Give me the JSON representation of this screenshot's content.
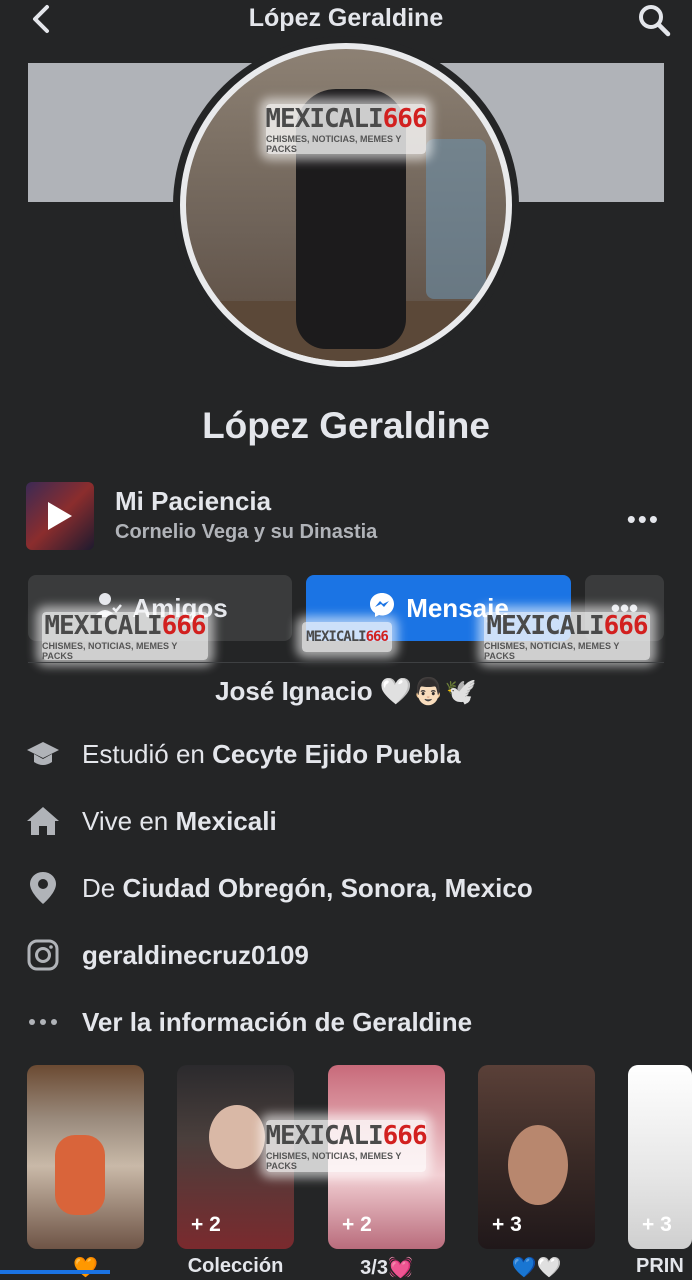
{
  "header": {
    "title": "López Geraldine",
    "back_icon": "chevron-left-icon",
    "search_icon": "search-icon"
  },
  "watermark": {
    "brand_white": "MEXICALI",
    "brand_red": "666",
    "tagline": "CHISMES, NOTICIAS, MEMES Y PACKS"
  },
  "profile": {
    "name": "López Geraldine"
  },
  "music": {
    "title": "Mi Paciencia",
    "artist": "Cornelio Vega y su Dinastia",
    "more": "•••"
  },
  "actions": {
    "friends_label": "Amigos",
    "message_label": "Mensaje",
    "more_label": "•••"
  },
  "bio": "José Ignacio 🤍👨🏻🕊️",
  "info": {
    "education_prefix": "Estudió en",
    "education_place": "Cecyte Ejido Puebla",
    "lives_prefix": "Vive en",
    "lives_place": "Mexicali",
    "from_prefix": "De",
    "from_place": "Ciudad Obregón, Sonora, Mexico",
    "instagram": "geraldinecruz0109",
    "see_more": "Ver la información de Geraldine"
  },
  "featured": [
    {
      "count": "",
      "label": "🧡"
    },
    {
      "count": "+ 2",
      "label": "Colección"
    },
    {
      "count": "+ 2",
      "label": "3/3💓"
    },
    {
      "count": "+ 3",
      "label": "💙🤍"
    },
    {
      "count": "+ 3",
      "label": "PRIN"
    }
  ],
  "colors": {
    "background": "#242526",
    "primary_blue": "#1b74e4",
    "secondary_button": "#3a3b3c",
    "text": "#e4e6eb",
    "muted_text": "#b0b3b8"
  }
}
